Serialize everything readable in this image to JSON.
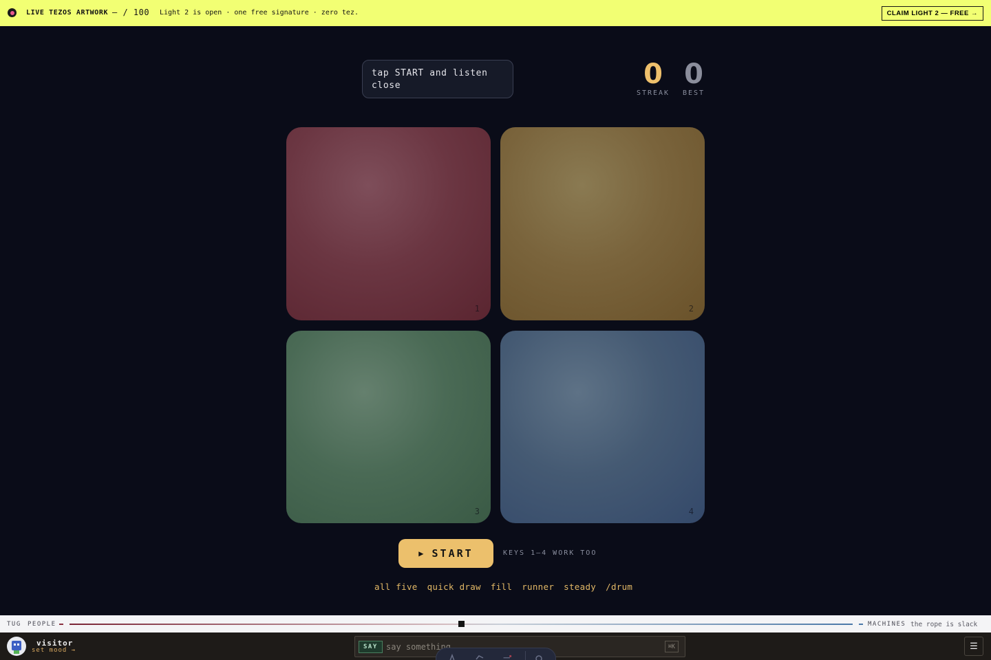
{
  "banner": {
    "live_label": "LIVE TEZOS ARTWORK",
    "count": "— / 100",
    "message": "Light 2 is open · one free signature · zero tez.",
    "claim_label": "CLAIM LIGHT 2 — FREE →"
  },
  "game": {
    "hint": "tap START and listen close",
    "streak": {
      "value": "0",
      "label": "STREAK"
    },
    "best": {
      "value": "0",
      "label": "BEST"
    },
    "pads": [
      {
        "number": "1",
        "color": "#6b3642"
      },
      {
        "number": "2",
        "color": "#7a643c"
      },
      {
        "number": "3",
        "color": "#4a6a55"
      },
      {
        "number": "4",
        "color": "#455a73"
      }
    ],
    "start_icon": "▶",
    "start_label": "START",
    "keys_hint": "KEYS 1–4 WORK TOO",
    "modes": [
      "all five",
      "quick draw",
      "fill",
      "runner",
      "steady",
      "/drum"
    ]
  },
  "tug": {
    "label": "TUG",
    "left": "PEOPLE",
    "right": "MACHINES",
    "status": "the rope is slack",
    "position": 0.5
  },
  "footer": {
    "user_name": "visitor",
    "mood_link": "set mood →",
    "say_label": "SAY",
    "say_placeholder": "say something",
    "shortcut": "⌘K",
    "menu_icon": "☰"
  }
}
